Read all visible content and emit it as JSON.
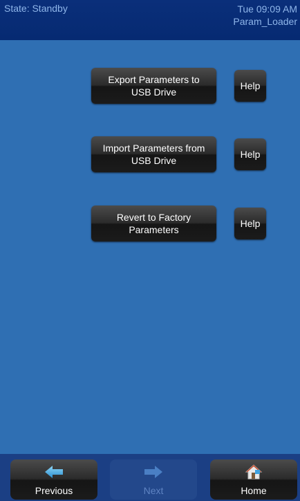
{
  "status": {
    "state": "State: Standby",
    "datetime": "Tue 09:09 AM",
    "screen_name": "Param_Loader"
  },
  "main": {
    "buttons": [
      {
        "label": "Export Parameters to\nUSB Drive",
        "help_label": "Help"
      },
      {
        "label": "Import Parameters from\nUSB Drive",
        "help_label": "Help"
      },
      {
        "label": "Revert to Factory\nParameters",
        "help_label": "Help"
      }
    ]
  },
  "nav": {
    "previous": {
      "label": "Previous",
      "icon": "arrow-left-icon"
    },
    "next": {
      "label": "Next",
      "icon": "arrow-right-icon",
      "enabled": false
    },
    "home": {
      "label": "Home",
      "icon": "home-icon"
    }
  },
  "colors": {
    "background": "#2f6fb3",
    "status_bar": "#0a2f7a",
    "status_text": "#8fb6ea",
    "button": "#2b2b2b",
    "arrow": "#48b2e6"
  }
}
